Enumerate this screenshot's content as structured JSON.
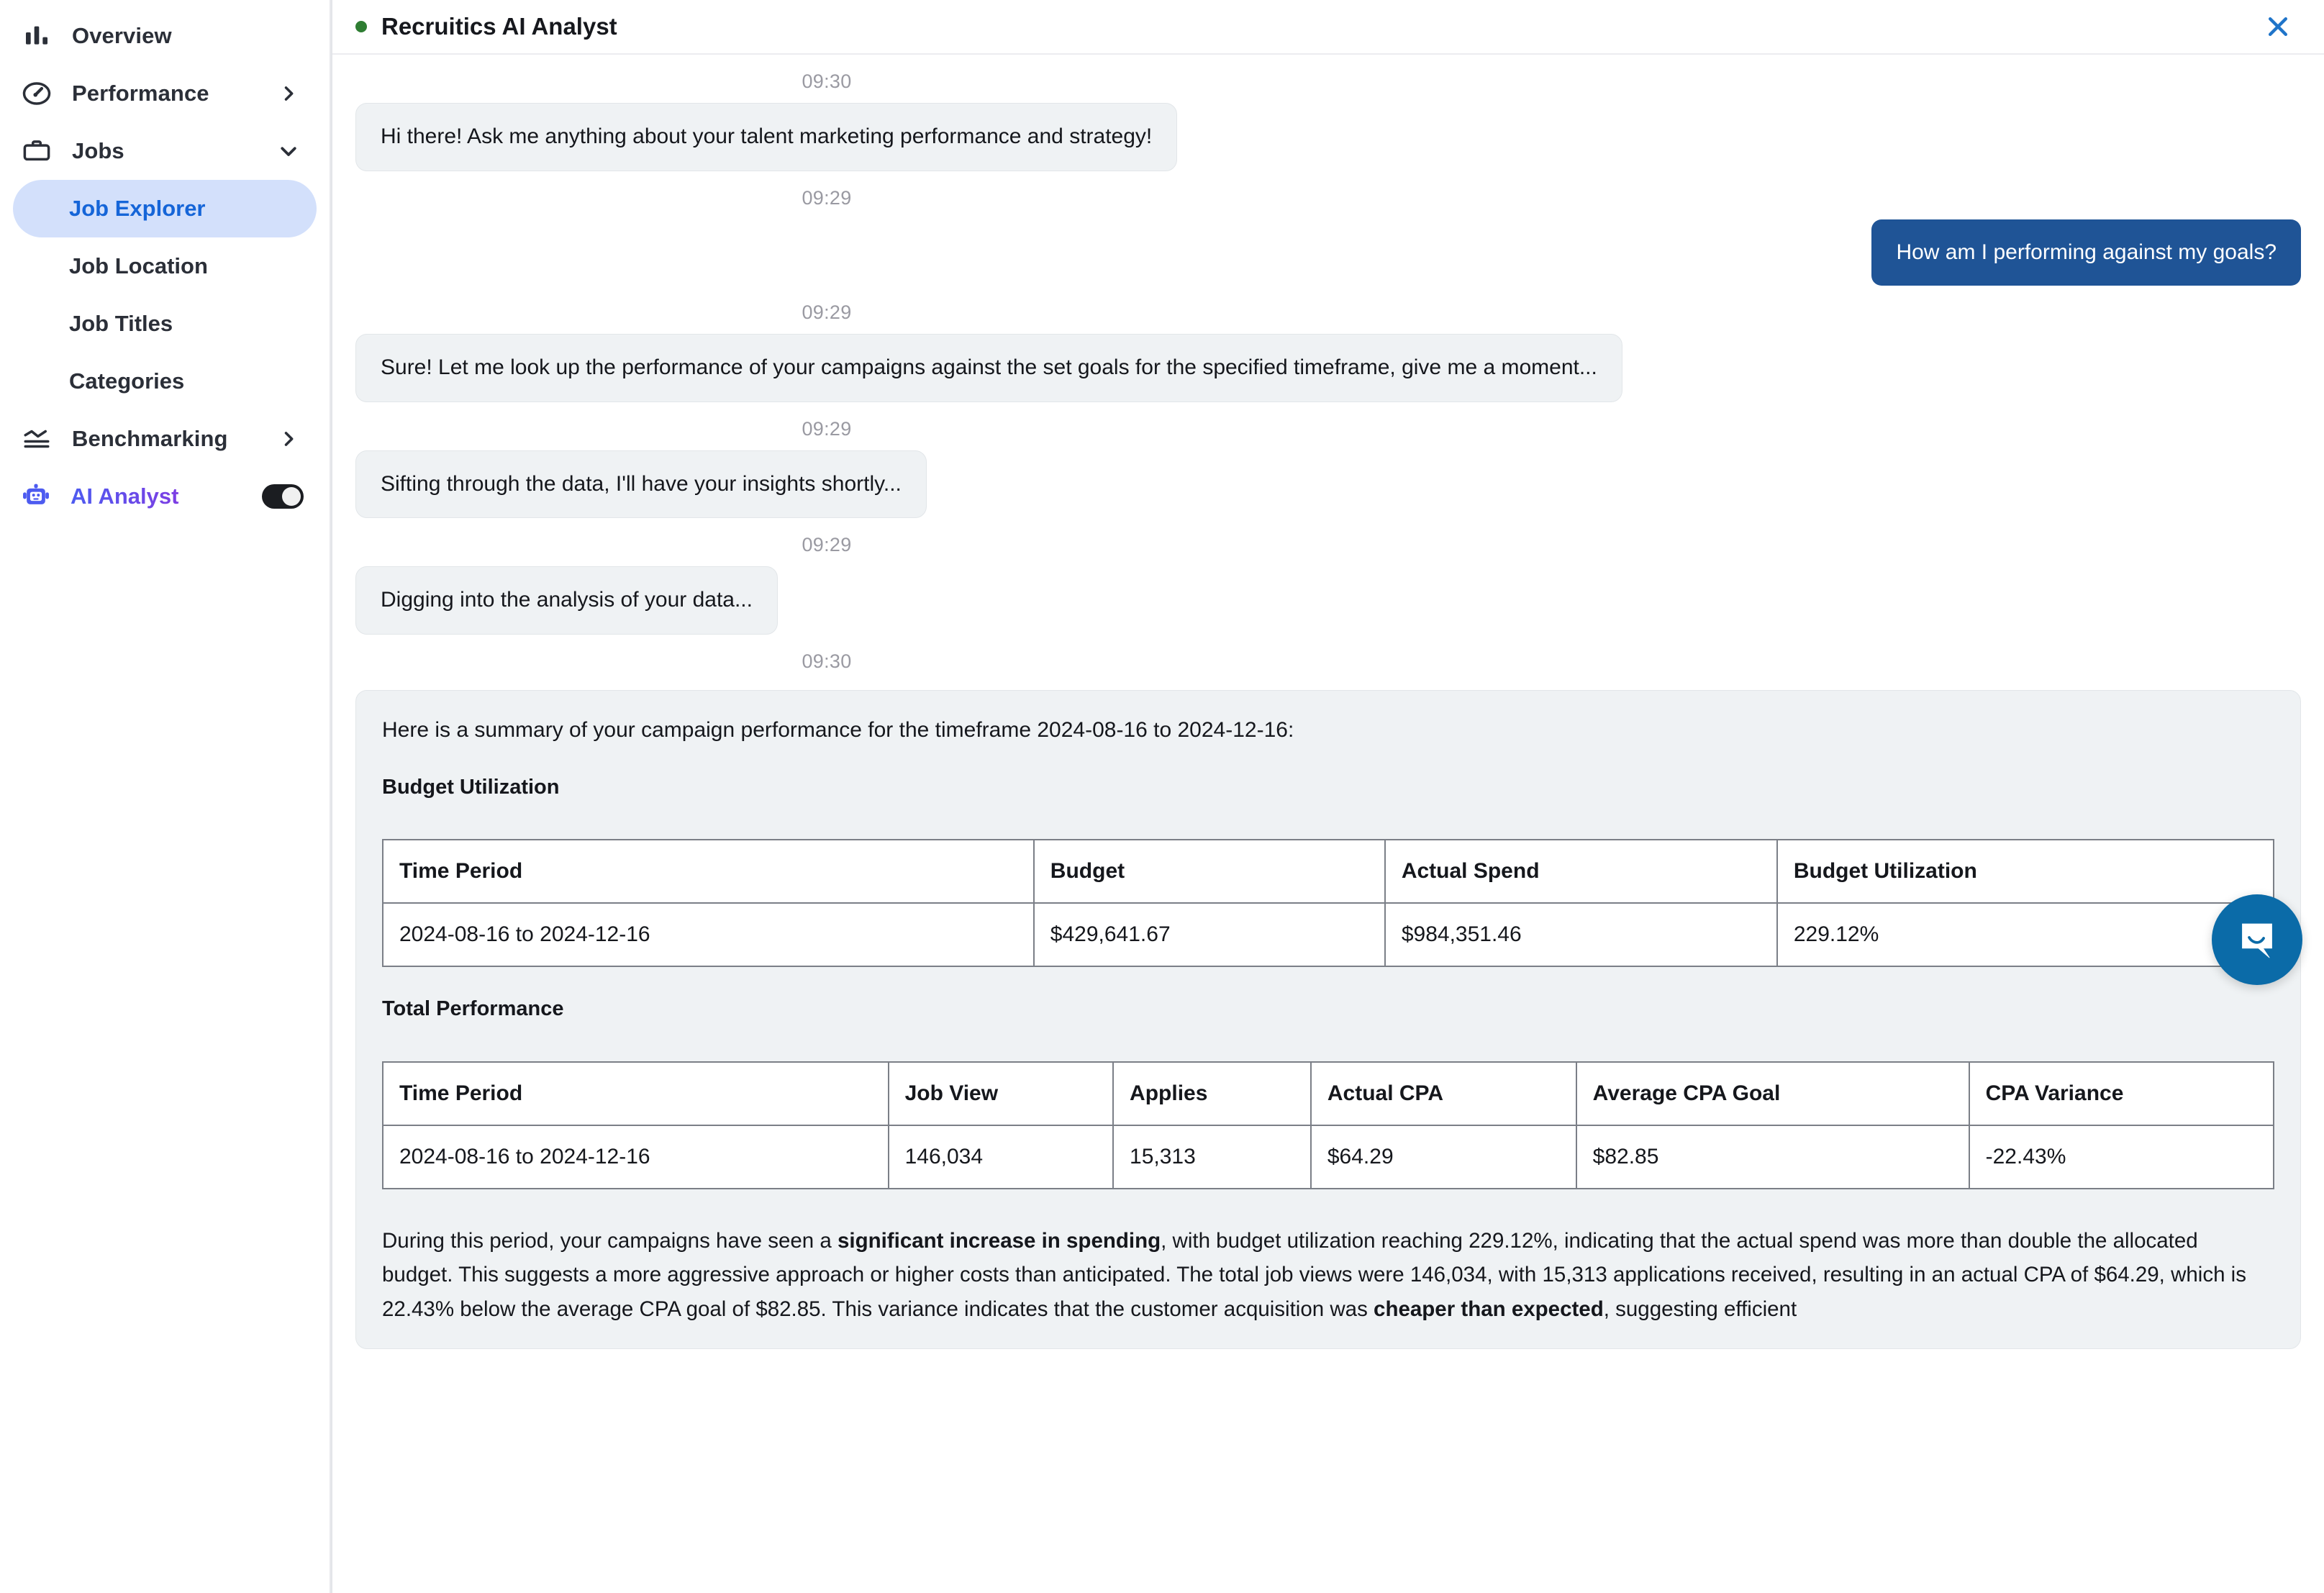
{
  "sidebar": {
    "items": [
      {
        "label": "Overview",
        "icon": "bar-chart-icon",
        "chevron": "none"
      },
      {
        "label": "Performance",
        "icon": "speedometer-icon",
        "chevron": "right"
      },
      {
        "label": "Jobs",
        "icon": "briefcase-icon",
        "chevron": "down"
      }
    ],
    "sub_items": [
      {
        "label": "Job Explorer",
        "active": true
      },
      {
        "label": "Job Location",
        "active": false
      },
      {
        "label": "Job Titles",
        "active": false
      },
      {
        "label": "Categories",
        "active": false
      }
    ],
    "benchmarking": {
      "label": "Benchmarking",
      "icon": "benchmark-icon",
      "chevron": "right"
    },
    "ai_analyst": {
      "label": "AI Analyst",
      "icon": "robot-icon",
      "toggle_on": true
    }
  },
  "panel": {
    "title": "Recruitics AI Analyst",
    "status_dot_color": "#2e7d32",
    "close_label": "×"
  },
  "chat": {
    "messages": [
      {
        "time": "09:30",
        "from": "bot",
        "text": "Hi there! Ask me anything about your talent marketing performance and strategy!"
      },
      {
        "time": "09:29",
        "from": "user",
        "text": "How am I performing against my goals?"
      },
      {
        "time": "09:29",
        "from": "bot",
        "text": "Sure! Let me look up the performance of your campaigns against the set goals for the specified timeframe, give me a moment..."
      },
      {
        "time": "09:29",
        "from": "bot",
        "text": "Sifting through the data, I'll have your insights shortly..."
      },
      {
        "time": "09:29",
        "from": "bot",
        "text": "Digging into the analysis of your data..."
      }
    ],
    "summary_time": "09:30"
  },
  "summary": {
    "intro": "Here is a summary of your campaign performance for the timeframe 2024-08-16 to 2024-12-16:",
    "budget_section_title": "Budget Utilization",
    "performance_section_title": "Total Performance",
    "budget_table": {
      "headers": [
        "Time Period",
        "Budget",
        "Actual Spend",
        "Budget Utilization"
      ],
      "rows": [
        [
          "2024-08-16 to 2024-12-16",
          "$429,641.67",
          "$984,351.46",
          "229.12%"
        ]
      ]
    },
    "performance_table": {
      "headers": [
        "Time Period",
        "Job View",
        "Applies",
        "Actual CPA",
        "Average CPA Goal",
        "CPA Variance"
      ],
      "rows": [
        [
          "2024-08-16 to 2024-12-16",
          "146,034",
          "15,313",
          "$64.29",
          "$82.85",
          "-22.43%"
        ]
      ]
    },
    "paragraph_part1": "During this period, your campaigns have seen a ",
    "paragraph_bold1": "significant increase in spending",
    "paragraph_part2": ", with budget utilization reaching 229.12%, indicating that the actual spend was more than double the allocated budget. This suggests a more aggressive approach or higher costs than anticipated. The total job views were 146,034, with 15,313 applications received, resulting in an actual CPA of $64.29, which is 22.43% below the average CPA goal of $82.85. This variance indicates that the customer acquisition was ",
    "paragraph_bold2": "cheaper than expected",
    "paragraph_part3": ", suggesting efficient "
  },
  "launcher": {
    "name": "intercom-messenger-button",
    "color": "#0b6ba8"
  }
}
